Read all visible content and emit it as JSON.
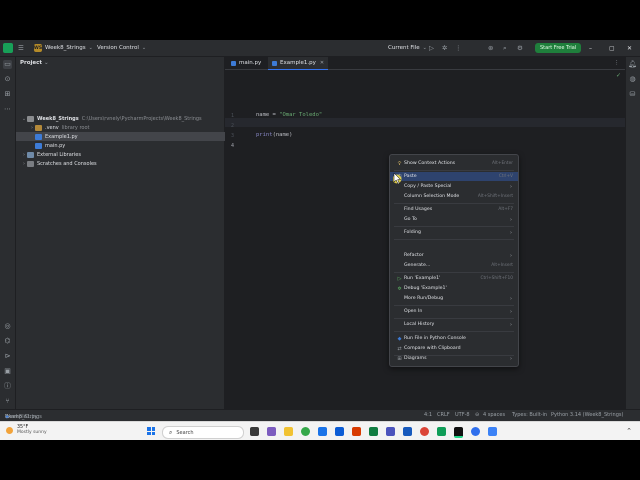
{
  "titlebar": {
    "project_badge": "WS",
    "project_name": "Week8_Strings",
    "vcs_label": "Version Control",
    "run_config": "Current File",
    "trial_button": "Start Free Trial"
  },
  "project_panel": {
    "header": "Project",
    "items": [
      {
        "label": "Week8_Strings",
        "hint": "C:\\Users\\rvnely\\PycharmProjects\\Week8_Strings",
        "icon": "folder-icon"
      },
      {
        "label": ".venv",
        "hint": "library root",
        "icon": "folder-icon"
      },
      {
        "label": "Example1.py",
        "hint": "",
        "icon": "python-file-icon"
      },
      {
        "label": "main.py",
        "hint": "",
        "icon": "python-file-icon"
      },
      {
        "label": "External Libraries",
        "hint": "",
        "icon": "library-icon"
      },
      {
        "label": "Scratches and Consoles",
        "hint": "",
        "icon": "scratch-icon"
      }
    ]
  },
  "editor": {
    "tabs": [
      {
        "label": "main.py",
        "active": false
      },
      {
        "label": "Example1.py",
        "active": true
      }
    ],
    "line_numbers": [
      "1",
      "2",
      "3",
      "4"
    ],
    "code": {
      "line1_var": "name = ",
      "line1_str": "\"Omar Toledo\"",
      "line3_fn": "print",
      "line3_args": "(name)"
    }
  },
  "context_menu": {
    "items": [
      {
        "label": "Show Context Actions",
        "shortcut": "Alt+Enter",
        "icon": "bulb-icon",
        "submenu": false
      },
      {
        "label": "Paste",
        "shortcut": "Ctrl+V",
        "icon": "paste-icon",
        "submenu": false
      },
      {
        "label": "Copy / Paste Special",
        "shortcut": "",
        "icon": "",
        "submenu": true
      },
      {
        "label": "Column Selection Mode",
        "shortcut": "Alt+Shift+Insert",
        "icon": "",
        "submenu": false
      },
      {
        "label": "Find Usages",
        "shortcut": "Alt+F7",
        "icon": "",
        "submenu": false
      },
      {
        "label": "Go To",
        "shortcut": "",
        "icon": "",
        "submenu": true
      },
      {
        "label": "Folding",
        "shortcut": "",
        "icon": "",
        "submenu": true
      },
      {
        "label": "Refactor",
        "shortcut": "",
        "icon": "",
        "submenu": true
      },
      {
        "label": "Generate...",
        "shortcut": "Alt+Insert",
        "icon": "",
        "submenu": false
      },
      {
        "label": "Run 'Example1'",
        "shortcut": "Ctrl+Shift+F10",
        "icon": "run-icon",
        "submenu": false
      },
      {
        "label": "Debug 'Example1'",
        "shortcut": "",
        "icon": "debug-icon",
        "submenu": false
      },
      {
        "label": "More Run/Debug",
        "shortcut": "",
        "icon": "",
        "submenu": true
      },
      {
        "label": "Open In",
        "shortcut": "",
        "icon": "",
        "submenu": true
      },
      {
        "label": "Local History",
        "shortcut": "",
        "icon": "",
        "submenu": true
      },
      {
        "label": "Run File in Python Console",
        "shortcut": "",
        "icon": "python-console-icon",
        "submenu": false
      },
      {
        "label": "Compare with Clipboard",
        "shortcut": "",
        "icon": "compare-icon",
        "submenu": false
      },
      {
        "label": "Diagrams",
        "shortcut": "",
        "icon": "diagram-icon",
        "submenu": true
      }
    ]
  },
  "statusbar": {
    "breadcrumb_project": "Week8_Strings",
    "breadcrumb_file": "Example1.py",
    "position": "4:1",
    "line_sep": "CRLF",
    "encoding": "UTF-8",
    "indent": "4 spaces",
    "types": "Types: Built-in",
    "interpreter": "Python 3.14 (Week8_Strings)"
  },
  "taskbar": {
    "weather_temp": "35°F",
    "weather_desc": "Mostly sunny",
    "search_placeholder": "Search"
  }
}
